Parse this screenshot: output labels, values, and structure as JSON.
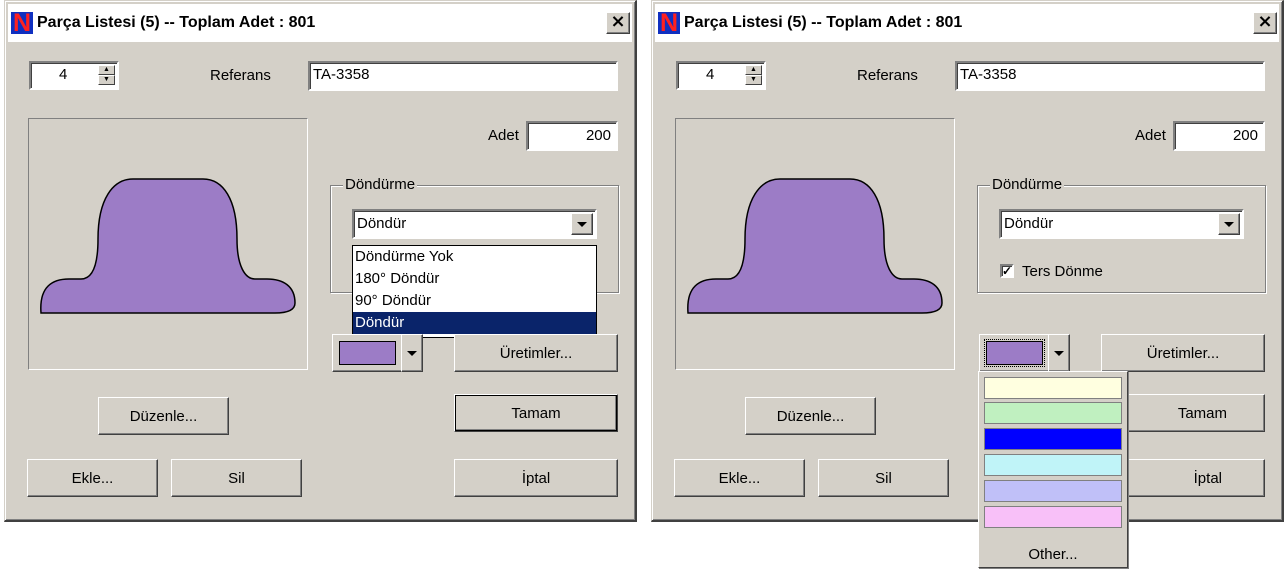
{
  "window": {
    "title": "Parça Listesi (5) -- Toplam Adet : 801",
    "close_glyph": "×",
    "logo_letter": "N",
    "index_value": "4",
    "referans_label": "Referans",
    "referans_value": "TA-3358",
    "adet_label": "Adet",
    "adet_value": "200",
    "rotation_group_label": "Döndürme",
    "rotation_selected": "Döndür",
    "rotation_options": [
      "Döndürme Yok",
      "180° Döndür",
      "90° Döndür",
      "Döndür"
    ],
    "reverse_label": "Ters Dönme",
    "reverse_checked": true,
    "reverse_check_glyph": "✓",
    "productions_button": "Üretimler...",
    "ok_button": "Tamam",
    "edit_button": "Düzenle...",
    "add_button": "Ekle...",
    "delete_button": "Sil",
    "cancel_button": "İptal",
    "part_color": "#9c7cc6"
  },
  "palette": {
    "colors": [
      "#ffffe0",
      "#c0f0c0",
      "#0000ff",
      "#c0f4f8",
      "#c0c0f8",
      "#f8c0f8"
    ],
    "other_label": "Other..."
  },
  "colors": {
    "title_bar_bg": "#ffffff",
    "dialog_bg": "#d4d0c8",
    "selection_bg": "#0a246a"
  },
  "icons": {
    "logo": "app-logo-icon",
    "close": "close-icon",
    "spin_up": "spin-up-icon",
    "spin_down": "spin-down-icon",
    "dropdown": "dropdown-arrow-icon",
    "check": "checkmark-icon"
  }
}
